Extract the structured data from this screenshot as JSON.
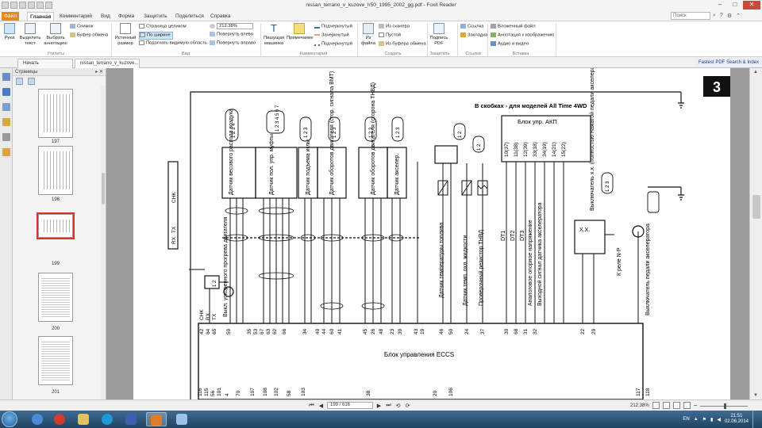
{
  "window": {
    "title": "nissan_terrano_v_kuzove_lr50_1995_2002_gg.pdf - Foxit Reader",
    "controls": [
      "–",
      "□",
      "✕"
    ]
  },
  "menu": {
    "tabs": [
      "Файл",
      "Главная",
      "Комментарий",
      "Вид",
      "Форма",
      "Защитить",
      "Поделиться",
      "Справка"
    ],
    "search_placeholder": "Поиск"
  },
  "ribbon": {
    "tools": {
      "hand": "Рука",
      "select_text": "Выделить текст",
      "select_annot": "Выбрать аннотацию",
      "snapshot": "Снимок",
      "clipboard": "Буфер обмена",
      "group": "Утилиты"
    },
    "view": {
      "actual_size": "Истинный размер",
      "fit_page": "Страница целиком",
      "fit_width": "По ширине",
      "fit_visible": "Подогнать видимую область",
      "zoom": "212.38%",
      "rotate_left": "Повернуть влево",
      "rotate_right": "Повернуть вправо",
      "group": "Вид"
    },
    "comment": {
      "typewriter": "Пишущая машинка",
      "note": "Примечание",
      "underline": "Подчеркнутый",
      "strikeout": "Зачеркнутый",
      "squiggly": "Подчеркнутый",
      "group": "Комментарий"
    },
    "create": {
      "from_file": "Из файла",
      "from_scanner": "Из сканера",
      "blank": "Пустой",
      "from_clipboard": "Из буфера обмена",
      "group": "Создать"
    },
    "protect": {
      "sign": "Подпись PDF",
      "group": "Защитить"
    },
    "links": {
      "link": "Ссылка",
      "bookmark": "Закладка",
      "group": "Ссылки"
    },
    "insert": {
      "attached_file": "Вложенный файл",
      "image_annot": "Аннотация к изображению",
      "audio_video": "Аудио и видео",
      "group": "Вставка"
    }
  },
  "doc_tabs": {
    "home": "Начать",
    "document": "nissan_terrano_v_kuzove...",
    "fastpdf": "Fastest PDF Search & Index"
  },
  "pages_panel": {
    "title": "Страницы",
    "thumbs": [
      "197",
      "198",
      "199",
      "200",
      "201"
    ],
    "selected": "199"
  },
  "schematic": {
    "page_badge": "3",
    "note_4wd": "В скобках - для моделей All Time 4WD",
    "akp_block": "Блок упр. АКП",
    "ecu_block": "Блок управления ECCS",
    "akp_pins": [
      "10(37)",
      "11(38)",
      "12(39)",
      "33(18)",
      "34(19)",
      "14(21)",
      "15(22)"
    ],
    "akp_signals": [
      "DT1",
      "DT2",
      "DT3",
      "Аналоговое опорное напряжение",
      "Выходной сигнал датчика акселератора"
    ],
    "sensors": [
      "Датчик весового расхода воздуха",
      "Датчик пол. упр. муфты",
      "Датчик подъема иглы",
      "Датчик оборотов двигателя (стор. сигнала ВМТ)",
      "Датчик оборотов двигателя (сторона ТНВД)",
      "Датчик акселер."
    ],
    "right_sensors": [
      "Датчик температуры топлива",
      "Датчик темп. охл. жидкости",
      "Проверочный резистор ТНВД"
    ],
    "idle_switch": "Выключатель х.х. (полностью нажатой педали акселератора)",
    "pedal_switch": "Выключатель педали акселератора",
    "kn_p": "К реле N-P",
    "xx": "X.X.",
    "preheat": "Выкл. ускоренного прогрева двигателя",
    "diag": [
      "CHK",
      "RX",
      "TX"
    ],
    "pins_top": [
      "42",
      "64",
      "65",
      "59",
      "35",
      "53",
      "67",
      "63",
      "62",
      "66",
      "34",
      "40",
      "44",
      "60",
      "41",
      "45",
      "26",
      "48",
      "23",
      "39",
      "43",
      "19",
      "46",
      "50",
      "24",
      "37",
      "30",
      "68",
      "31",
      "32",
      "22",
      "29"
    ],
    "pins_bottom": [
      "116",
      "115",
      "56",
      "101",
      "4",
      "70",
      "107",
      "108",
      "102",
      "58",
      "103",
      "38",
      "20",
      "106",
      "117",
      "118"
    ],
    "connectors": [
      "1 2 3 4",
      "1 2 3 4 5 6 7",
      "1 2 3",
      "1 2 3",
      "1 2 3",
      "1 2 3",
      "1 2 3",
      "1 2",
      "1 2",
      "1 2"
    ]
  },
  "status": {
    "page": "199 / 616",
    "zoom": "212.38%"
  },
  "taskbar": {
    "lang": "EN",
    "time": "21:51",
    "date": "02.06.2014"
  }
}
